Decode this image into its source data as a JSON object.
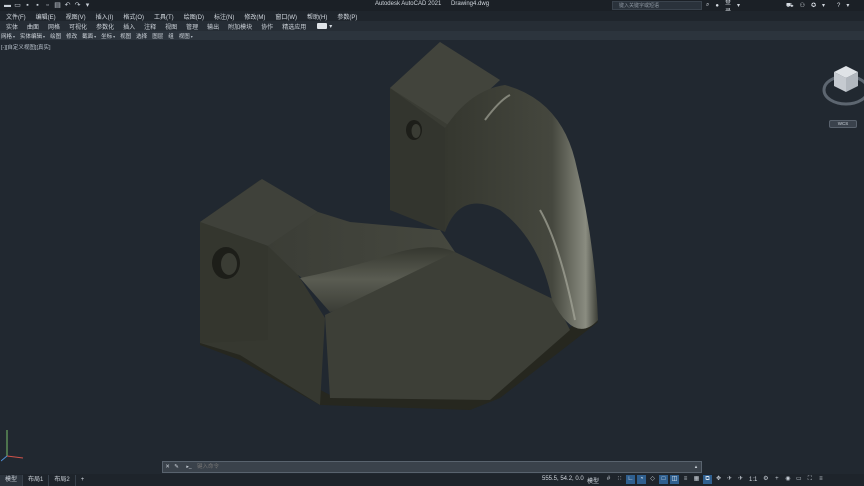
{
  "window": {
    "app_name": "Autodesk AutoCAD 2021",
    "file_name": "Drawing4.dwg",
    "search_placeholder": "键入关键字或短语",
    "login": "登录"
  },
  "menu": [
    "文件(F)",
    "编辑(E)",
    "视图(V)",
    "插入(I)",
    "格式(O)",
    "工具(T)",
    "绘图(D)",
    "标注(N)",
    "修改(M)",
    "窗口(W)",
    "帮助(H)",
    "参数(P)"
  ],
  "ribbon_tabs": [
    "实体",
    "曲面",
    "网格",
    "可视化",
    "参数化",
    "插入",
    "注释",
    "视图",
    "管理",
    "输出",
    "附加模块",
    "协作",
    "精选应用"
  ],
  "panels": [
    {
      "label": "网格",
      "dd": true
    },
    {
      "label": "实体编辑",
      "dd": true
    },
    {
      "label": "绘图",
      "dd": false
    },
    {
      "label": "修改",
      "dd": false
    },
    {
      "label": "截面",
      "dd": true
    },
    {
      "label": "坐标",
      "dd": true
    },
    {
      "label": "视图",
      "dd": false
    },
    {
      "label": "选择",
      "dd": false
    },
    {
      "label": "图层",
      "dd": false
    },
    {
      "label": "组",
      "dd": false
    },
    {
      "label": "视图",
      "dd": true
    }
  ],
  "viewport_label": "[-][自定义视图][真实]",
  "viewcube": {
    "wcs_label": "WCS"
  },
  "command": {
    "placeholder": "键入命令",
    "prompt": "▸_"
  },
  "layout_tabs": [
    "模型",
    "布局1",
    "布局2"
  ],
  "add_layout": "+",
  "status": {
    "coordinates": "555.5, 54.2, 0.0",
    "mode": "模型",
    "scale": "1:1"
  },
  "colors": {
    "model_face": "#3f413a",
    "model_dark": "#2c2e28",
    "model_light": "#5a5c52",
    "background": "#212830"
  }
}
